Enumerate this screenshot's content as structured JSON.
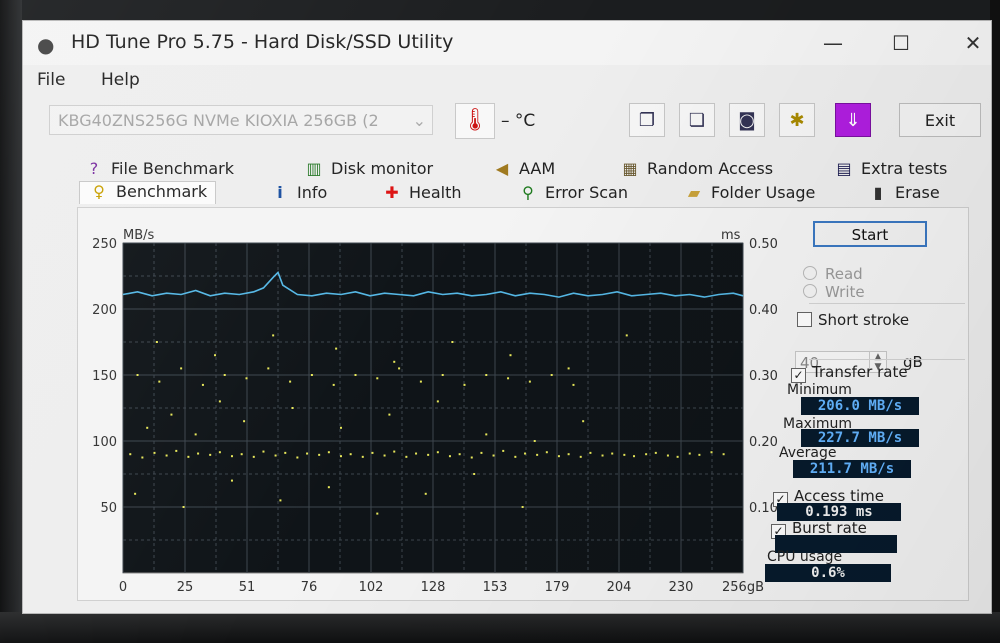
{
  "window": {
    "title": "HD Tune Pro 5.75 - Hard Disk/SSD Utility",
    "minimize_glyph": "—",
    "maximize_glyph": "☐",
    "close_glyph": "✕"
  },
  "menu": {
    "file": "File",
    "help": "Help"
  },
  "toolbar": {
    "drive": "KBG40ZNS256G NVMe KIOXIA 256GB (2",
    "temperature": "– °C",
    "exit_label": "Exit",
    "icons": [
      "thermometer-icon",
      "copy-icon",
      "copy-all-icon",
      "camera-icon",
      "options-icon",
      "save-icon"
    ]
  },
  "tabs": {
    "row1": [
      {
        "label": "File Benchmark",
        "icon": "file-benchmark-icon"
      },
      {
        "label": "Disk monitor",
        "icon": "disk-monitor-icon"
      },
      {
        "label": "AAM",
        "icon": "speaker-icon"
      },
      {
        "label": "Random Access",
        "icon": "random-access-icon"
      },
      {
        "label": "Extra tests",
        "icon": "extra-tests-icon"
      }
    ],
    "row2": [
      {
        "label": "Benchmark",
        "icon": "benchmark-icon",
        "active": true
      },
      {
        "label": "Info",
        "icon": "info-icon"
      },
      {
        "label": "Health",
        "icon": "health-icon"
      },
      {
        "label": "Error Scan",
        "icon": "error-scan-icon"
      },
      {
        "label": "Folder Usage",
        "icon": "folder-icon"
      },
      {
        "label": "Erase",
        "icon": "trash-icon"
      }
    ]
  },
  "controls": {
    "start_label": "Start",
    "read_label": "Read",
    "write_label": "Write",
    "short_stroke_label": "Short stroke",
    "short_stroke_value": "40",
    "short_stroke_unit": "gB",
    "transfer_rate_label": "Transfer rate",
    "minimum_label": "Minimum",
    "minimum_value": "206.0 MB/s",
    "maximum_label": "Maximum",
    "maximum_value": "227.7 MB/s",
    "average_label": "Average",
    "average_value": "211.7 MB/s",
    "access_time_label": "Access time",
    "access_time_value": "0.193 ms",
    "burst_rate_label": "Burst rate",
    "burst_rate_value": "",
    "cpu_usage_label": "CPU usage",
    "cpu_usage_value": "0.6%",
    "checked": {
      "short_stroke": false,
      "transfer_rate": true,
      "access_time": true,
      "burst_rate": true
    }
  },
  "chart_data": {
    "type": "line",
    "x_ticks": [
      "0",
      "25",
      "51",
      "76",
      "102",
      "128",
      "153",
      "179",
      "204",
      "230",
      "256gB"
    ],
    "xlim": [
      0,
      256
    ],
    "y_left_label": "MB/s",
    "y_left_ticks": [
      "250",
      "200",
      "150",
      "100",
      "50"
    ],
    "ylim_left": [
      0,
      250
    ],
    "y_right_label": "ms",
    "y_right_ticks": [
      "0.50",
      "0.40",
      "0.30",
      "0.20",
      "0.10"
    ],
    "ylim_right": [
      0,
      0.5
    ],
    "grid": true,
    "colors": {
      "background": "#0f1418",
      "grid": "#3d464e",
      "transfer": "#55b8e6",
      "access": "#e8e85a"
    },
    "series": [
      {
        "kind": "transfer-rate",
        "axis": "left",
        "x": [
          0,
          6,
          12,
          18,
          24,
          30,
          36,
          42,
          48,
          54,
          58,
          62,
          64,
          66,
          72,
          78,
          84,
          90,
          96,
          102,
          108,
          114,
          120,
          126,
          132,
          138,
          144,
          150,
          156,
          162,
          168,
          174,
          180,
          186,
          192,
          198,
          204,
          210,
          216,
          222,
          228,
          234,
          240,
          246,
          252,
          256
        ],
        "values": [
          211,
          213,
          210,
          212,
          211,
          214,
          210,
          212,
          211,
          213,
          216,
          224,
          227.7,
          218,
          211,
          210,
          212,
          211,
          213,
          210,
          212,
          211,
          210,
          213,
          211,
          212,
          210,
          211,
          213,
          210,
          212,
          211,
          209,
          212,
          210,
          211,
          213,
          210,
          211,
          212,
          210,
          211,
          209,
          211,
          212,
          210
        ]
      },
      {
        "kind": "access-time",
        "axis": "right",
        "x": [
          3,
          8,
          13,
          18,
          22,
          27,
          31,
          36,
          40,
          45,
          49,
          54,
          58,
          63,
          67,
          72,
          76,
          81,
          85,
          90,
          94,
          99,
          103,
          108,
          112,
          117,
          121,
          126,
          130,
          135,
          139,
          144,
          148,
          153,
          157,
          162,
          166,
          171,
          175,
          180,
          184,
          189,
          193,
          198,
          202,
          207,
          211,
          216,
          220,
          225,
          229,
          234,
          238,
          243,
          248,
          6,
          15,
          24,
          33,
          42,
          51,
          60,
          69,
          78,
          87,
          96,
          105,
          114,
          123,
          132,
          141,
          150,
          159,
          168,
          177,
          186,
          10,
          20,
          30,
          40,
          50,
          70,
          90,
          110,
          130,
          150,
          170,
          190,
          5,
          25,
          45,
          65,
          85,
          105,
          125,
          145,
          165,
          14,
          38,
          62,
          88,
          112,
          136,
          160,
          184,
          208
        ],
        "values": [
          0.18,
          0.175,
          0.182,
          0.178,
          0.185,
          0.176,
          0.181,
          0.179,
          0.183,
          0.177,
          0.18,
          0.176,
          0.184,
          0.178,
          0.182,
          0.175,
          0.181,
          0.179,
          0.183,
          0.177,
          0.18,
          0.176,
          0.182,
          0.178,
          0.184,
          0.176,
          0.181,
          0.179,
          0.183,
          0.177,
          0.18,
          0.175,
          0.182,
          0.178,
          0.185,
          0.176,
          0.181,
          0.179,
          0.183,
          0.177,
          0.18,
          0.176,
          0.182,
          0.178,
          0.181,
          0.179,
          0.177,
          0.18,
          0.182,
          0.178,
          0.176,
          0.181,
          0.179,
          0.183,
          0.18,
          0.3,
          0.29,
          0.31,
          0.285,
          0.3,
          0.295,
          0.31,
          0.29,
          0.3,
          0.285,
          0.3,
          0.295,
          0.31,
          0.29,
          0.3,
          0.285,
          0.3,
          0.295,
          0.29,
          0.3,
          0.285,
          0.22,
          0.24,
          0.21,
          0.26,
          0.23,
          0.25,
          0.22,
          0.24,
          0.26,
          0.21,
          0.2,
          0.23,
          0.12,
          0.1,
          0.14,
          0.11,
          0.13,
          0.09,
          0.12,
          0.15,
          0.1,
          0.35,
          0.33,
          0.36,
          0.34,
          0.32,
          0.35,
          0.33,
          0.31,
          0.36
        ]
      }
    ]
  }
}
